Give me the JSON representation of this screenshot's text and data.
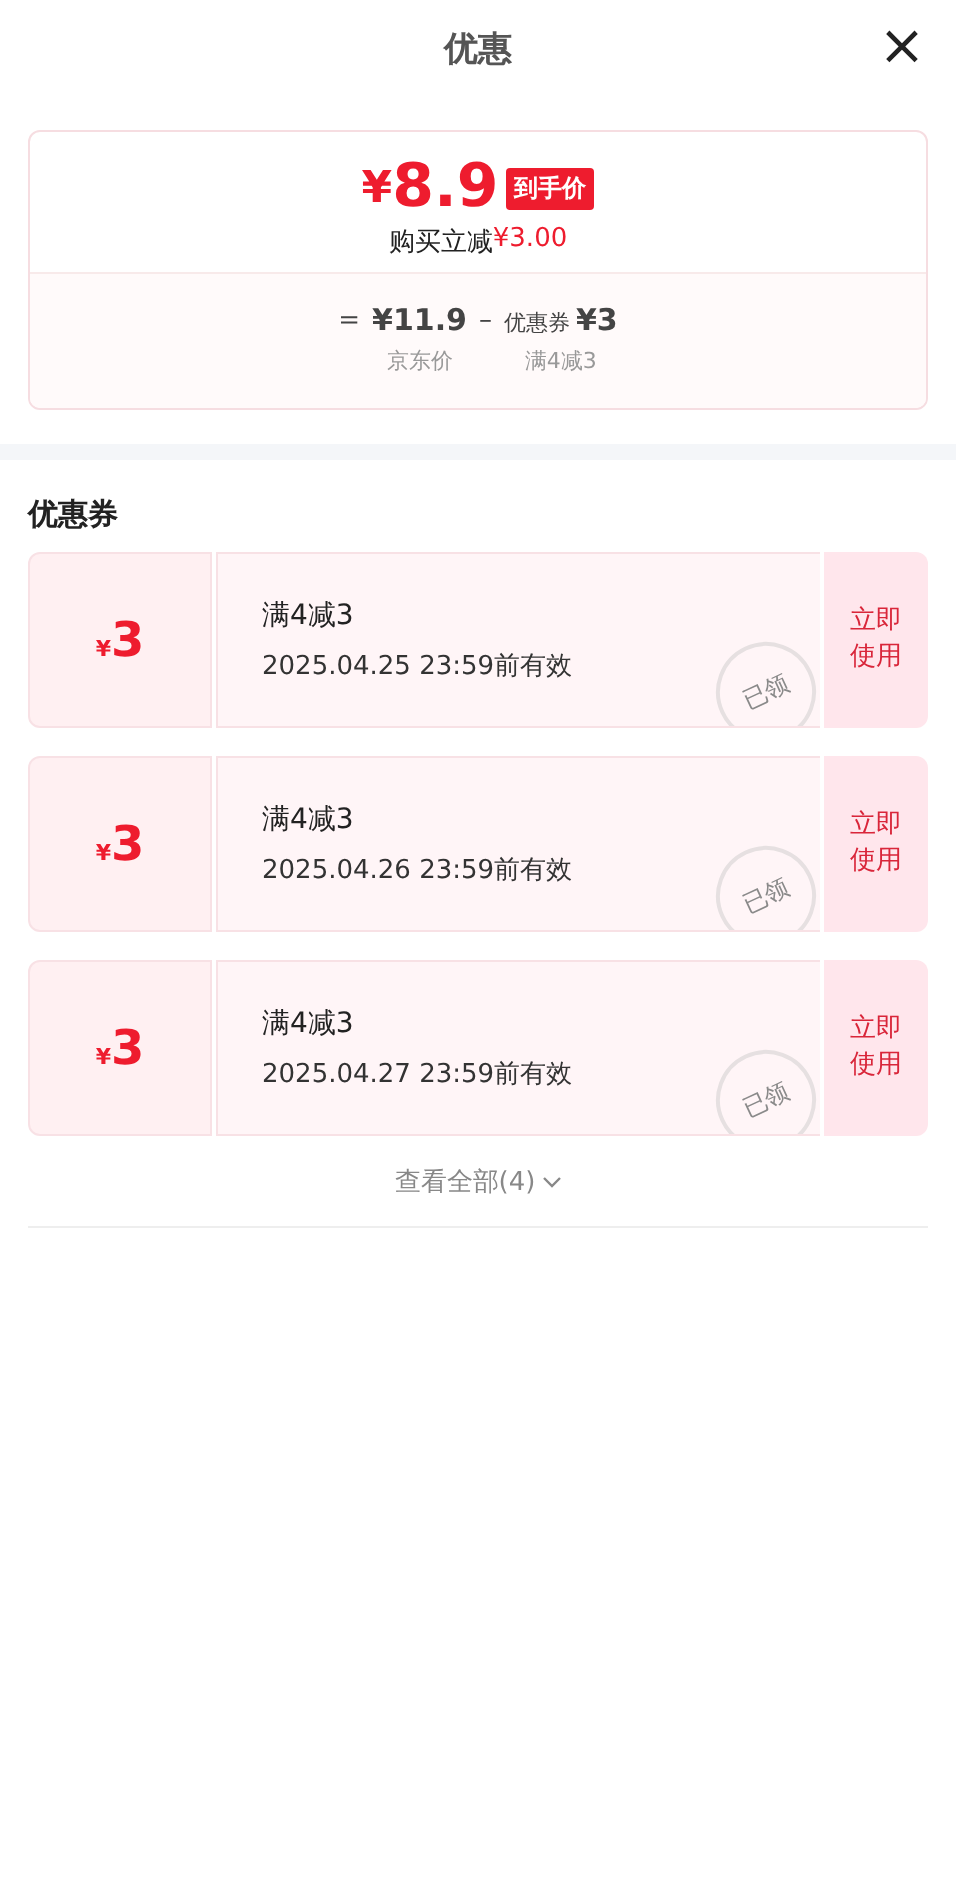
{
  "header": {
    "title": "优惠",
    "close": "×"
  },
  "summary": {
    "currency": "¥",
    "price": "8.9",
    "badge": "到手价",
    "saving_label": "购买立减",
    "saving_amount": "¥3.00",
    "breakdown": [
      {
        "kind": "op",
        "text": "="
      },
      {
        "kind": "amount",
        "text": "¥11.9",
        "caption": "京东价"
      },
      {
        "kind": "op",
        "text": "–"
      },
      {
        "kind": "coupon",
        "label": "优惠券",
        "text": "¥3",
        "caption": "满4减3"
      }
    ]
  },
  "coupons_section": {
    "title": "优惠券",
    "coupons": [
      {
        "currency": "¥",
        "amount": "3",
        "rule": "满4减3",
        "validity": "2025.04.25 23:59前有效",
        "action": "立即使用",
        "stamp": "已领"
      },
      {
        "currency": "¥",
        "amount": "3",
        "rule": "满4减3",
        "validity": "2025.04.26 23:59前有效",
        "action": "立即使用",
        "stamp": "已领"
      },
      {
        "currency": "¥",
        "amount": "3",
        "rule": "满4减3",
        "validity": "2025.04.27 23:59前有效",
        "action": "立即使用",
        "stamp": "已领"
      }
    ],
    "view_all": "查看全部(4)"
  }
}
